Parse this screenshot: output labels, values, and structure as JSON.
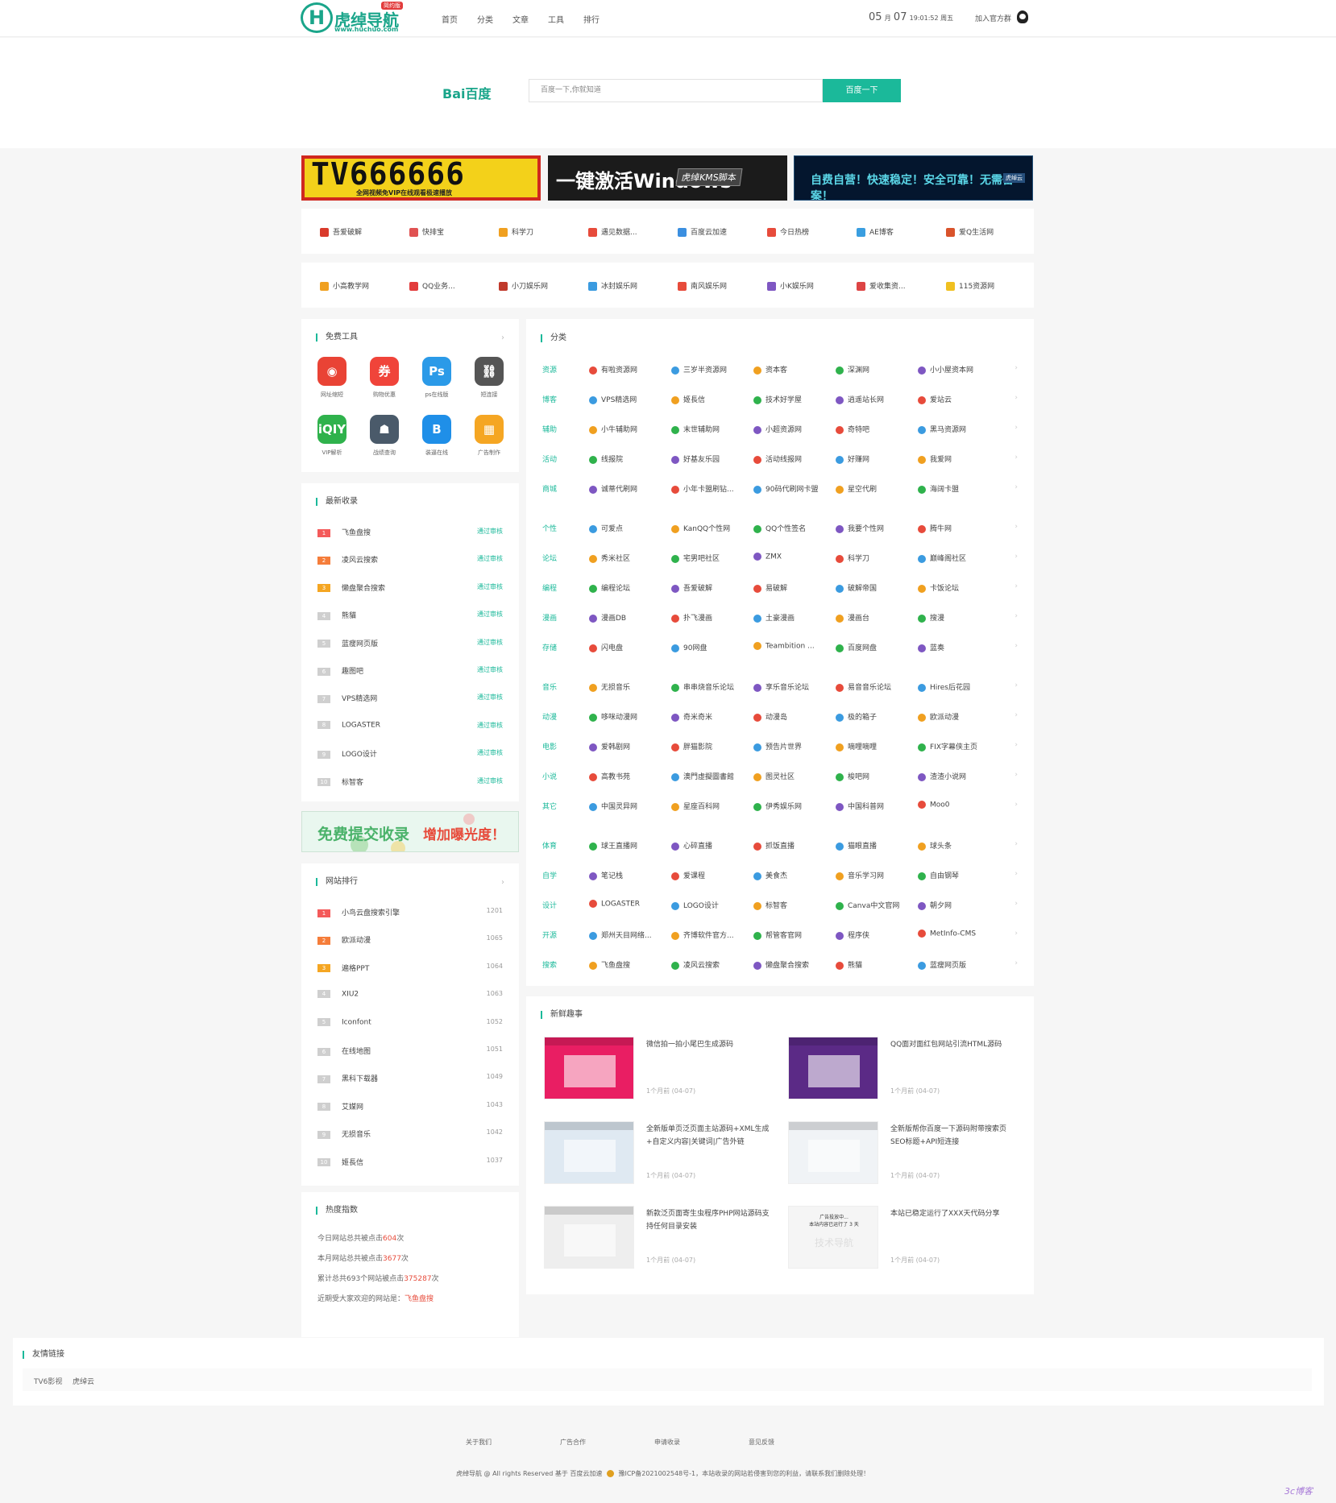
{
  "header": {
    "logo_title": "虎绰导航",
    "logo_url": "www.huchuo.com",
    "logo_badge": "简约版",
    "nav": [
      "首页",
      "分类",
      "文章",
      "工具",
      "排行"
    ],
    "date_month": "05",
    "date_month_unit": "月",
    "date_day": "07",
    "date_time": "19:01:52 周五",
    "join_group": "加入官方群"
  },
  "search": {
    "engine_logo": "Bai百度",
    "placeholder": "百度一下,你就知道",
    "button": "百度一下"
  },
  "banners": [
    {
      "title": "TV666666",
      "subtitle": "全网视频免VIP在线观看极速播放"
    },
    {
      "title": "一键激活Windows",
      "tag": "虎绰KMS脚本"
    },
    {
      "title": "自费自营！快速稳定！安全可靠！无需备案！",
      "tag": "虎绰云"
    }
  ],
  "quick_row1": [
    {
      "label": "吾爱破解",
      "color": "#d93a2b"
    },
    {
      "label": "快排宝",
      "color": "#e05252"
    },
    {
      "label": "科学刀",
      "color": "#f0a020"
    },
    {
      "label": "遇见数据...",
      "color": "#e74b3b"
    },
    {
      "label": "百度云加速",
      "color": "#3b8fe0"
    },
    {
      "label": "今日热榜",
      "color": "#e74b3b"
    },
    {
      "label": "AE博客",
      "color": "#3a9ee0"
    },
    {
      "label": "爱Q生活网",
      "color": "#d9532b"
    }
  ],
  "quick_row2": [
    {
      "label": "小高教学网",
      "color": "#f0a020"
    },
    {
      "label": "QQ业务...",
      "color": "#e23b3b"
    },
    {
      "label": "小刀娱乐网",
      "color": "#c0392b"
    },
    {
      "label": "冰封娱乐网",
      "color": "#3b9be0"
    },
    {
      "label": "南风娱乐网",
      "color": "#e74b3b"
    },
    {
      "label": "小K娱乐网",
      "color": "#7e57c2"
    },
    {
      "label": "爱收集资...",
      "color": "#d44"
    },
    {
      "label": "115资源网",
      "color": "#f0c020"
    }
  ],
  "tools": {
    "title": "免费工具",
    "more": "›",
    "items": [
      {
        "label": "网址缩短",
        "glyph": "◉",
        "color": "#e94335"
      },
      {
        "label": "购物优惠",
        "glyph": "券",
        "color": "#f0443a"
      },
      {
        "label": "ps在线版",
        "glyph": "Ps",
        "color": "#2b9ae8"
      },
      {
        "label": "短连接",
        "glyph": "⛓",
        "color": "#555555"
      },
      {
        "label": "VIP解析",
        "glyph": "iQIY",
        "color": "#2fb24c"
      },
      {
        "label": "战绩查询",
        "glyph": "☗",
        "color": "#4a5a6a"
      },
      {
        "label": "装逼在线",
        "glyph": "B",
        "color": "#1f8fe8"
      },
      {
        "label": "广告制作",
        "glyph": "▦",
        "color": "#f5a623"
      }
    ]
  },
  "latest": {
    "title": "最新收录",
    "status": "通过审核",
    "items": [
      "飞鱼盘搜",
      "凌风云搜索",
      "懒盘聚合搜索",
      "熊貓",
      "蓝瘦网页版",
      "趣图吧",
      "VPS精选网",
      "LOGASTER",
      "LOGO设计",
      "标智客"
    ]
  },
  "promo": {
    "left": "免费提交收录",
    "right": "增加曝光度！"
  },
  "ranking": {
    "title": "网站排行",
    "more": "›",
    "items": [
      {
        "name": "小鸟云盘搜索引擎",
        "count": "1201"
      },
      {
        "name": "欧派动漫",
        "count": "1065"
      },
      {
        "name": "遍格PPT",
        "count": "1064"
      },
      {
        "name": "XIU2",
        "count": "1063"
      },
      {
        "name": "Iconfont",
        "count": "1052"
      },
      {
        "name": "在线地图",
        "count": "1051"
      },
      {
        "name": "黑科下载器",
        "count": "1049"
      },
      {
        "name": "艾媒网",
        "count": "1043"
      },
      {
        "name": "无损音乐",
        "count": "1042"
      },
      {
        "name": "姬長信",
        "count": "1037"
      }
    ]
  },
  "heat": {
    "title": "热度指数",
    "line1_pre": "今日网站总共被点击",
    "line1_val": "604",
    "line1_post": "次",
    "line2_pre": "本月网站总共被点击",
    "line2_val": "3677",
    "line2_post": "次",
    "line3_pre": "累计总共693个网站被点击",
    "line3_val": "375287",
    "line3_post": "次",
    "line4_pre": "近期受大家欢迎的网站是：",
    "line4_link": "飞鱼盘搜"
  },
  "categories": {
    "title": "分类",
    "groups": [
      [
        {
          "name": "资源",
          "items": [
            "有啦资源网",
            "三岁半资源网",
            "资本客",
            "深渊网",
            "小小屋资本网"
          ]
        },
        {
          "name": "博客",
          "items": [
            "VPS精选网",
            "姬長信",
            "技术好学屋",
            "逍遥站长网",
            "爱站云"
          ]
        },
        {
          "name": "辅助",
          "items": [
            "小牛辅助网",
            "末世辅助网",
            "小超资源网",
            "奇特吧",
            "黑马资源网"
          ]
        },
        {
          "name": "活动",
          "items": [
            "线报院",
            "好基友乐园",
            "活动线报网",
            "好赚网",
            "我爱网"
          ]
        },
        {
          "name": "商城",
          "items": [
            "诚蒂代刷网",
            "小年卡盟刷钻...",
            "90码代刷网卡盟",
            "星空代刷",
            "海阔卡盟"
          ]
        }
      ],
      [
        {
          "name": "个性",
          "items": [
            "可爱点",
            "KanQQ个性网",
            "QQ个性签名",
            "我要个性网",
            "腾牛网"
          ]
        },
        {
          "name": "论坛",
          "items": [
            "秀米社区",
            "宅男吧社区",
            "ZMX",
            "科学刀",
            "巅峰阁社区"
          ]
        },
        {
          "name": "编程",
          "items": [
            "编程论坛",
            "吾爱破解",
            "易破解",
            "破解帝国",
            "卡饭论坛"
          ]
        },
        {
          "name": "漫画",
          "items": [
            "漫画DB",
            "扑飞漫画",
            "土豪漫画",
            "漫画台",
            "搜漫"
          ]
        },
        {
          "name": "存储",
          "items": [
            "闪电盘",
            "90网盘",
            "Teambition ...",
            "百度网盘",
            "蓝奏"
          ]
        }
      ],
      [
        {
          "name": "音乐",
          "items": [
            "无损音乐",
            "串串烧音乐论坛",
            "享乐音乐论坛",
            "易音音乐论坛",
            "Hires后花园"
          ]
        },
        {
          "name": "动漫",
          "items": [
            "哆咪动漫网",
            "奇米奇米",
            "动漫岛",
            "极的箱子",
            "欧派动漫"
          ]
        },
        {
          "name": "电影",
          "items": [
            "爱韩剧网",
            "胖猫影院",
            "预告片世界",
            "嘀哩嘀哩",
            "FIX字幕侠主页"
          ]
        },
        {
          "name": "小说",
          "items": [
            "高教书苑",
            "澳門虛擬圖書館",
            "图灵社区",
            "梭吧网",
            "渣渣小说网"
          ]
        },
        {
          "name": "其它",
          "items": [
            "中国灵异网",
            "星座百科网",
            "伊秀娱乐网",
            "中国科普网",
            "Moo0"
          ]
        }
      ],
      [
        {
          "name": "体育",
          "items": [
            "球王直播网",
            "心碎直播",
            "抓饭直播",
            "猫眼直播",
            "球头条"
          ]
        },
        {
          "name": "自学",
          "items": [
            "笔记栈",
            "爱课程",
            "美食杰",
            "音乐学习网",
            "自由钢琴"
          ]
        },
        {
          "name": "设计",
          "items": [
            "LOGASTER",
            "LOGO设计",
            "标智客",
            "Canva中文官网",
            "朝夕网"
          ]
        },
        {
          "name": "开源",
          "items": [
            "郑州天目网络...",
            "齐博软件官方...",
            "帮管客官网",
            "程序侠",
            "MetInfo-CMS"
          ]
        },
        {
          "name": "搜索",
          "items": [
            "飞鱼盘搜",
            "凌风云搜索",
            "懒盘聚合搜索",
            "熊貓",
            "蓝瘦网页版"
          ]
        }
      ]
    ],
    "icon_colors": [
      "#e74b3b",
      "#3b9be0",
      "#f0a020",
      "#2fb24c",
      "#7e57c2"
    ]
  },
  "news": {
    "title": "新鲜趣事",
    "items": [
      {
        "title": "微信拍一拍小尾巴生成源码",
        "date": "1个月前 (04-07)",
        "thumb": "#e91e63"
      },
      {
        "title": "QQ面对面红包网站引流HTML源码",
        "date": "1个月前 (04-07)",
        "thumb": "#5b2a86"
      },
      {
        "title": "全新版单页泛页面主站源码+XML生成+自定义内容|关键词|广告外链",
        "date": "1个月前 (04-07)",
        "thumb": "#dfe9f2"
      },
      {
        "title": "全新版帮你百度一下源码附带搜索页SEO标题+API短连接",
        "date": "1个月前 (04-07)",
        "thumb": "#f0f3f6"
      },
      {
        "title": "新款泛页面寄生虫程序PHP网站源码支持任何目录安装",
        "date": "1个月前 (04-07)",
        "thumb": "#eeeeee"
      },
      {
        "title": "本站已稳定运行了XXX天代码分享",
        "date": "1个月前 (04-07)",
        "thumb": "#f5f5f5"
      }
    ],
    "thumb5_caption": "广告投放中...\n本站内容已运行了 3 天",
    "thumb5_watermark": "技术导航"
  },
  "friends": {
    "title": "友情链接",
    "links": [
      "TV6影视",
      "虎绰云"
    ]
  },
  "footer": {
    "links": [
      "关于我们",
      "广告合作",
      "申请收录",
      "意见反馈"
    ],
    "copyright": "虎绰导航 @ All rights Reserved 基于 百度云加速",
    "icp": "豫ICP备2021002548号-1，本站收录的网站若侵害到您的利益，请联系我们删除处理！"
  },
  "watermark": "3c博客"
}
